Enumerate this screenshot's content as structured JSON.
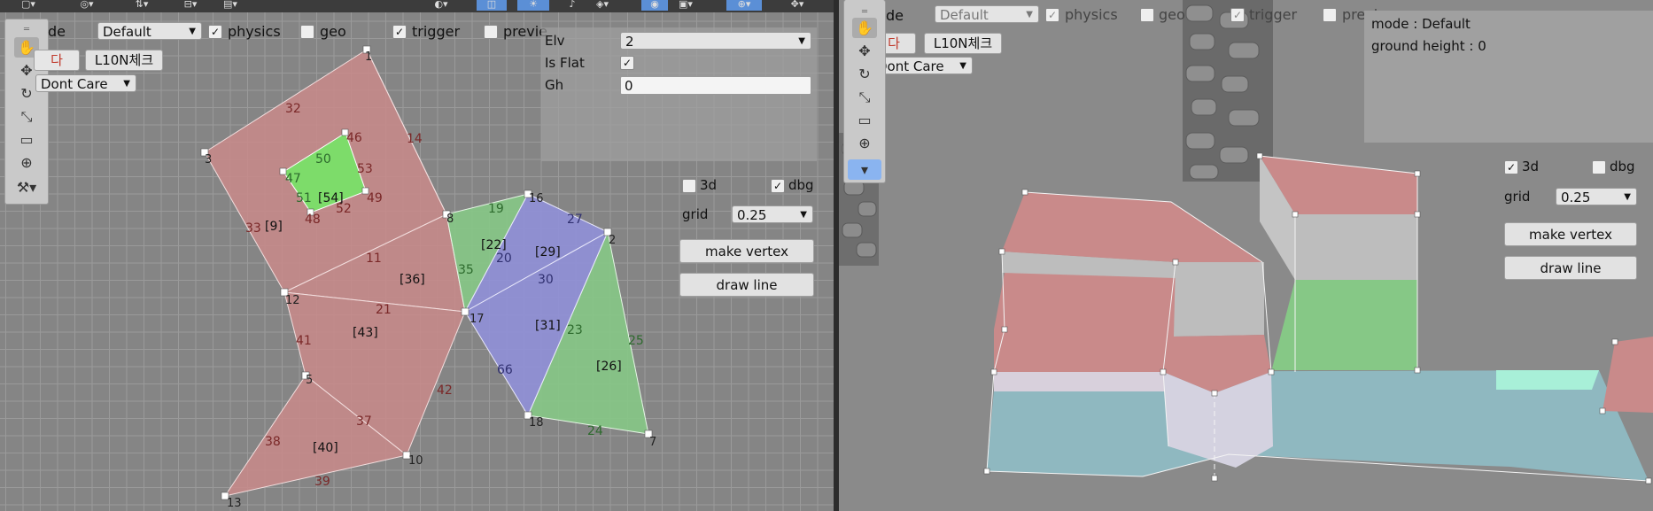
{
  "left": {
    "toolbar_row": {
      "mode_label": "de",
      "mode_value": "Default",
      "physics": "physics",
      "geo": "geo",
      "trigger": "trigger",
      "preview": "previe"
    },
    "korean_tab": "다",
    "l10n_button": "L10N체크",
    "dont_care": "Dont Care",
    "inspector": {
      "elv_label": "Elv",
      "elv_value": "2",
      "isflat_label": "Is Flat",
      "gh_label": "Gh",
      "gh_value": "0"
    },
    "options": {
      "three_d": "3d",
      "dbg": "dbg",
      "grid_label": "grid",
      "grid_value": "0.25",
      "make_vertex": "make vertex",
      "draw_line": "draw line"
    },
    "vertex_labels": [
      "1",
      "3",
      "12",
      "5",
      "13",
      "10",
      "8",
      "17",
      "16",
      "2",
      "18",
      "7",
      "47",
      "46",
      "49",
      "48"
    ],
    "edge_labels_red": [
      "32",
      "14",
      "33",
      "11",
      "21",
      "41",
      "42",
      "37",
      "38",
      "39",
      "53",
      "52",
      "51"
    ],
    "edge_labels_green": [
      "19",
      "35",
      "23",
      "25",
      "24",
      "50",
      "47",
      "51"
    ],
    "edge_labels_blue": [
      "27",
      "20",
      "30",
      "66"
    ],
    "face_labels": [
      "[9]",
      "[36]",
      "[43]",
      "[40]",
      "[22]",
      "[29]",
      "[31]",
      "[26]",
      "[54]"
    ]
  },
  "right": {
    "toolbar_row": {
      "mode_label": "de",
      "mode_value": "Default",
      "physics": "physics",
      "geo": "geo",
      "trigger": "trigger",
      "preview": "previ"
    },
    "korean_tab": "다",
    "l10n_button": "L10N체크",
    "dont_care": "Dont Care",
    "info": {
      "mode": "mode : Default",
      "ground_height": "ground height : 0"
    },
    "options": {
      "three_d": "3d",
      "dbg": "dbg",
      "grid_label": "grid",
      "grid_value": "0.25",
      "make_vertex": "make vertex",
      "draw_line": "draw line"
    }
  },
  "colors": {
    "red_face": "#c98a8a",
    "green_face": "#86c886",
    "blue_face": "#9090d8",
    "bright_green": "#7ddc6a",
    "teal_base": "#8fb8c0"
  }
}
